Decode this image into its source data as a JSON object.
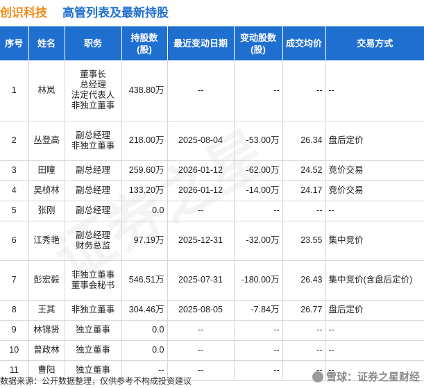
{
  "title": {
    "company": "创识科技",
    "text": "高管列表及最新持股"
  },
  "columns": [
    "序号",
    "姓名",
    "职务",
    "持股数\n(股)",
    "最近变动日期",
    "变动股数\n(股)",
    "成交均价",
    "交易方式"
  ],
  "rows": [
    {
      "idx": "1",
      "name": "林岚",
      "title": "董事长\n总经理\n法定代表人\n非独立董事",
      "shares": "438.80万",
      "date": "--",
      "change": "--",
      "price": "--",
      "method": "--"
    },
    {
      "idx": "2",
      "name": "丛登高",
      "title": "副总经理\n非独立董事",
      "shares": "218.00万",
      "date": "2025-08-04",
      "change": "-53.00万",
      "price": "26.34",
      "method": "盘后定价"
    },
    {
      "idx": "3",
      "name": "田瞳",
      "title": "副总经理",
      "shares": "259.60万",
      "date": "2026-01-12",
      "change": "-62.00万",
      "price": "24.52",
      "method": "竞价交易"
    },
    {
      "idx": "4",
      "name": "吴桢林",
      "title": "副总经理",
      "shares": "133.20万",
      "date": "2026-01-12",
      "change": "-14.00万",
      "price": "24.17",
      "method": "竞价交易"
    },
    {
      "idx": "5",
      "name": "张刚",
      "title": "副总经理",
      "shares": "0.0",
      "date": "--",
      "change": "--",
      "price": "--",
      "method": "--"
    },
    {
      "idx": "6",
      "name": "江秀艳",
      "title": "副总经理\n财务总监",
      "shares": "97.19万",
      "date": "2025-12-31",
      "change": "-32.00万",
      "price": "23.55",
      "method": "集中竞价"
    },
    {
      "idx": "7",
      "name": "彭宏毅",
      "title": "非独立董事\n董事会秘书",
      "shares": "546.51万",
      "date": "2025-07-31",
      "change": "-180.00万",
      "price": "26.43",
      "method": "集中竞价(含盘后定价)"
    },
    {
      "idx": "8",
      "name": "王其",
      "title": "非独立董事",
      "shares": "304.46万",
      "date": "2025-08-05",
      "change": "-7.84万",
      "price": "26.77",
      "method": "盘后定价"
    },
    {
      "idx": "9",
      "name": "林锦贤",
      "title": "独立董事",
      "shares": "0.0",
      "date": "--",
      "change": "--",
      "price": "--",
      "method": "--"
    },
    {
      "idx": "10",
      "name": "曾政林",
      "title": "独立董事",
      "shares": "0.0",
      "date": "--",
      "change": "--",
      "price": "--",
      "method": "--"
    },
    {
      "idx": "11",
      "name": "曹阳",
      "title": "独立董事",
      "shares": "--",
      "date": "--",
      "change": "--",
      "price": "--",
      "method": "--"
    }
  ],
  "footer": "数据来源：公开数据整理，仅供参考不构成投资建议",
  "brand": "雪球：证券之星财经",
  "watermark": "证券之星",
  "colors": {
    "header_bg": "#1f6fd1",
    "company": "#f08a17",
    "title": "#1f6fd1",
    "value_green": "#1b9a3a"
  }
}
